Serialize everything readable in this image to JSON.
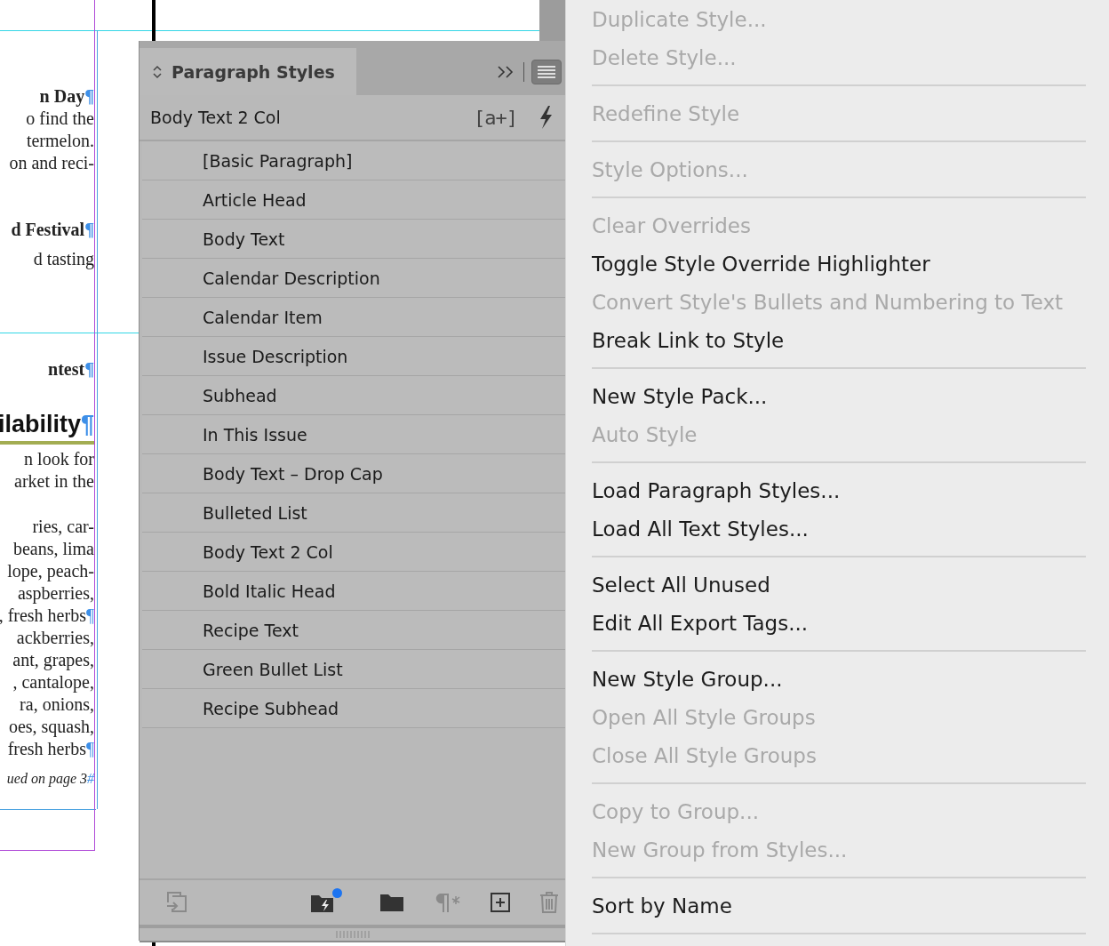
{
  "document": {
    "lines": [
      {
        "text": "n Day",
        "kind": "head",
        "mark": "¶"
      },
      {
        "text": "o find the",
        "kind": "body"
      },
      {
        "text": "termelon.",
        "kind": "body"
      },
      {
        "text": "on and reci-",
        "kind": "body"
      },
      {
        "kind": "gap"
      },
      {
        "text": "d Festival",
        "kind": "head",
        "mark": "¶"
      },
      {
        "text": "d tasting",
        "kind": "body"
      },
      {
        "kind": "section-break"
      },
      {
        "text": "ntest",
        "kind": "head",
        "mark": "¶"
      },
      {
        "text": "ilability",
        "kind": "title",
        "mark": "¶"
      },
      {
        "text": "n look for",
        "kind": "body"
      },
      {
        "text": "arket in the",
        "kind": "body"
      },
      {
        "kind": "line-gap"
      },
      {
        "text": "ries, car-",
        "kind": "body"
      },
      {
        "text": "beans, lima",
        "kind": "body"
      },
      {
        "text": "lope, peach-",
        "kind": "body"
      },
      {
        "text": "aspberries,",
        "kind": "body"
      },
      {
        "text": ", fresh herbs",
        "kind": "body",
        "mark": "¶"
      },
      {
        "text": "ackberries,",
        "kind": "body"
      },
      {
        "text": "ant, grapes,",
        "kind": "body"
      },
      {
        "text": ", cantalope,",
        "kind": "body"
      },
      {
        "text": "ra, onions,",
        "kind": "body"
      },
      {
        "text": "oes, squash,",
        "kind": "body"
      },
      {
        "text": "fresh herbs",
        "kind": "body",
        "mark": "¶"
      },
      {
        "text": "ued on page 3",
        "kind": "jump",
        "mark": "#"
      }
    ]
  },
  "panel": {
    "title": "Paragraph Styles",
    "menu_open": true,
    "current_style": "Body Text 2 Col",
    "override_label": "[a+]",
    "styles": [
      {
        "name": "[Basic Paragraph]",
        "selected": false
      },
      {
        "name": "Article Head",
        "selected": false
      },
      {
        "name": "Body Text",
        "selected": false
      },
      {
        "name": "Calendar Description",
        "selected": false
      },
      {
        "name": "Calendar Item",
        "selected": false
      },
      {
        "name": "Issue Description",
        "selected": false
      },
      {
        "name": "Subhead",
        "selected": false
      },
      {
        "name": "In This Issue",
        "selected": false
      },
      {
        "name": "Body Text – Drop Cap",
        "selected": false
      },
      {
        "name": "Bulleted List",
        "selected": false
      },
      {
        "name": "Body Text 2 Col",
        "selected": false
      },
      {
        "name": "Bold Italic Head",
        "selected": false
      },
      {
        "name": "Recipe Text",
        "selected": false
      },
      {
        "name": "Green Bullet List",
        "selected": false
      },
      {
        "name": "Recipe Subhead",
        "selected": false
      }
    ],
    "footer": [
      {
        "kind": "load",
        "disabled": true
      },
      {
        "kind": "style-group-lightning",
        "disabled": false,
        "badge": true
      },
      {
        "kind": "divider"
      },
      {
        "kind": "folder",
        "disabled": false
      },
      {
        "kind": "clear-overrides",
        "disabled": true
      },
      {
        "kind": "new",
        "disabled": false
      },
      {
        "kind": "delete",
        "disabled": true
      }
    ]
  },
  "menu": {
    "items": [
      {
        "kind": "item",
        "label": "Duplicate Style...",
        "disabled": true
      },
      {
        "kind": "item",
        "label": "Delete Style...",
        "disabled": true
      },
      {
        "kind": "separator"
      },
      {
        "kind": "item",
        "label": "Redefine Style",
        "disabled": true
      },
      {
        "kind": "separator"
      },
      {
        "kind": "item",
        "label": "Style Options...",
        "disabled": true
      },
      {
        "kind": "separator"
      },
      {
        "kind": "item",
        "label": "Clear Overrides",
        "disabled": true
      },
      {
        "kind": "item",
        "label": "Toggle Style Override Highlighter",
        "disabled": false
      },
      {
        "kind": "item",
        "label": "Convert Style's Bullets and Numbering to Text",
        "disabled": true
      },
      {
        "kind": "item",
        "label": "Break Link to Style",
        "disabled": false
      },
      {
        "kind": "separator"
      },
      {
        "kind": "item",
        "label": "New Style Pack...",
        "disabled": false
      },
      {
        "kind": "item",
        "label": "Auto Style",
        "disabled": true
      },
      {
        "kind": "separator"
      },
      {
        "kind": "item",
        "label": "Load Paragraph Styles...",
        "disabled": false
      },
      {
        "kind": "item",
        "label": "Load All Text Styles...",
        "disabled": false
      },
      {
        "kind": "separator"
      },
      {
        "kind": "item",
        "label": "Select All Unused",
        "disabled": false
      },
      {
        "kind": "item",
        "label": "Edit All Export Tags...",
        "disabled": false
      },
      {
        "kind": "separator"
      },
      {
        "kind": "item",
        "label": "New Style Group...",
        "disabled": false
      },
      {
        "kind": "item",
        "label": "Open All Style Groups",
        "disabled": true
      },
      {
        "kind": "item",
        "label": "Close All Style Groups",
        "disabled": true
      },
      {
        "kind": "separator"
      },
      {
        "kind": "item",
        "label": "Copy to Group...",
        "disabled": true
      },
      {
        "kind": "item",
        "label": "New Group from Styles...",
        "disabled": true
      },
      {
        "kind": "separator"
      },
      {
        "kind": "item",
        "label": "Sort by Name",
        "disabled": false
      },
      {
        "kind": "separator"
      }
    ]
  }
}
